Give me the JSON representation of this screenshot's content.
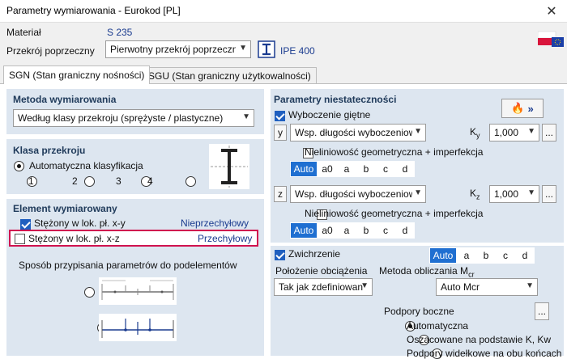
{
  "window": {
    "title": "Parametry wymiarowania - Eurokod [PL]",
    "close_label": "✕"
  },
  "header": {
    "material_label": "Materiał",
    "material_value": "S 235",
    "section_label": "Przekrój poprzeczny",
    "section_combo": "Pierwotny przekrój poprzeczny",
    "section_name": "IPE 400"
  },
  "tabs": [
    {
      "label": "SGN (Stan graniczny nośności)"
    },
    {
      "label": "SGU (Stan graniczny użytkowalności)"
    }
  ],
  "left": {
    "method": {
      "title": "Metoda wymiarowania",
      "combo": "Według klasy przekroju (sprężyste / plastyczne)"
    },
    "class": {
      "title": "Klasa przekroju",
      "auto_label": "Automatyczna klasyfikacja",
      "options": [
        "1",
        "2",
        "3",
        "4"
      ]
    },
    "element": {
      "title": "Element wymiarowany",
      "row1_label": "Stężony w lok. pł. x-y",
      "row1_value": "Nieprzechyłowy",
      "row2_label": "Stężony w lok. pł. x-z",
      "row2_value": "Przechyłowy",
      "assign_label": "Sposób przypisania parametrów do podelementów"
    }
  },
  "right": {
    "title": "Parametry niestateczności",
    "flex_label": "Wyboczenie giętne",
    "y_axis": "y",
    "z_axis": "z",
    "y_combo": "Wsp. długości wyboczeniowej",
    "z_combo": "Wsp. długości wyboczeniowej",
    "ky_label": "K",
    "ky_sub": "y",
    "kz_label": "K",
    "kz_sub": "z",
    "ky_value": "1,000",
    "kz_value": "1,000",
    "nonlin_label": "Nieliniowość geometryczna + imperfekcja",
    "segments": [
      "Auto",
      "a0",
      "a",
      "b",
      "c",
      "d"
    ],
    "ltb_label": "Zwichrzenie",
    "ltb_segments": [
      "Auto",
      "a",
      "b",
      "c",
      "d"
    ],
    "load_pos_label": "Położenie obciążenia",
    "load_pos_value": "Tak jak zdefiniowano",
    "mcr_label": "Metoda obliczania M",
    "mcr_sub": "cr",
    "mcr_value": "Auto Mcr",
    "supports_label": "Podpory boczne",
    "supports_options": [
      "Automatyczna",
      "Oszacowane na podstawie K, Kw",
      "Podpory widełkowe na obu końcach"
    ],
    "dots": "..."
  },
  "colors": {
    "accent": "#1f6fd1",
    "group_bg": "#dde6f0",
    "highlight": "#d0124f",
    "title_blue": "#1f3a5a"
  }
}
